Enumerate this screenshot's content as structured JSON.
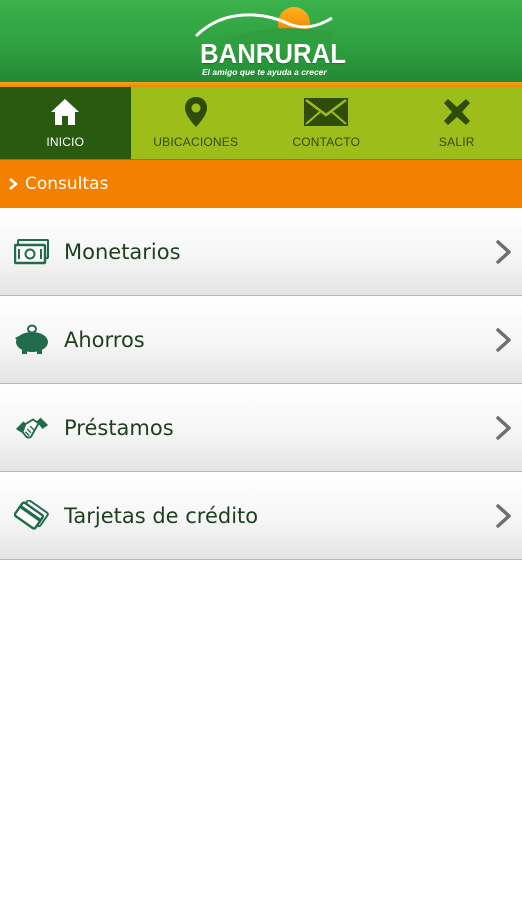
{
  "brand": {
    "name": "BANRURAL",
    "tagline": "El amigo que te ayuda a crecer",
    "colors": {
      "green": "#2f9e3f",
      "orange": "#f48000",
      "olive": "#9dbd1a",
      "dark_green": "#2a5a10"
    }
  },
  "nav": {
    "items": [
      {
        "label": "INICIO",
        "icon": "home-icon",
        "active": true
      },
      {
        "label": "UBICACIONES",
        "icon": "location-pin-icon",
        "active": false
      },
      {
        "label": "CONTACTO",
        "icon": "envelope-icon",
        "active": false
      },
      {
        "label": "SALIR",
        "icon": "close-x-icon",
        "active": false
      }
    ]
  },
  "section": {
    "title": "Consultas",
    "icon": "chevron-right-icon"
  },
  "menu": {
    "items": [
      {
        "label": "Monetarios",
        "icon": "money-icon"
      },
      {
        "label": "Ahorros",
        "icon": "piggy-bank-icon"
      },
      {
        "label": "Préstamos",
        "icon": "handshake-icon"
      },
      {
        "label": "Tarjetas de crédito",
        "icon": "credit-card-icon"
      }
    ]
  }
}
